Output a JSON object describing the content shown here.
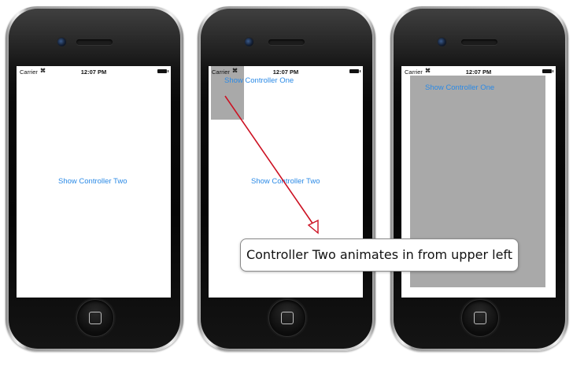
{
  "phones": [
    {
      "status": {
        "carrier": "Carrier",
        "time": "12:07 PM"
      },
      "button": "Show Controller Two"
    },
    {
      "status": {
        "carrier": "Carrier",
        "time": "12:07 PM"
      },
      "overlay_button": "Show Controller One",
      "button": "Show Controller Two"
    },
    {
      "status": {
        "carrier": "Carrier",
        "time": "12:07 PM"
      },
      "overlay_button": "Show Controller One"
    }
  ],
  "annotation": {
    "text": "Controller Two animates in from upper left"
  },
  "colors": {
    "link": "#2b8ae6",
    "overlay_gray": "#a9a9a9",
    "arrow": "#cc1122"
  }
}
